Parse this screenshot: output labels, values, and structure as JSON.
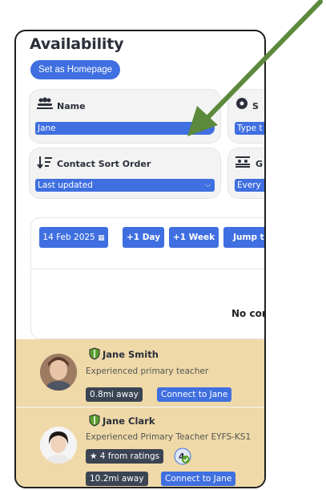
{
  "page": {
    "title": "Availability",
    "homepage_button": "Set as Homepage"
  },
  "filters": {
    "name": {
      "label": "Name",
      "value": "Jane"
    },
    "search_partial": {
      "label": "S",
      "placeholder": "Type t"
    },
    "sort": {
      "label": "Contact Sort Order",
      "value": "Last updated"
    },
    "group_partial": {
      "label": "G",
      "value": "Every"
    }
  },
  "date_toolbar": {
    "date": "14 Feb 2025",
    "plus_day": "+1 Day",
    "plus_week": "+1 Week",
    "jump": "Jump to"
  },
  "empty_state": "No conta",
  "contacts": [
    {
      "name": "Jane Smith",
      "description": "Experienced primary teacher",
      "distance": "0.8mi away",
      "connect": "Connect to Jane"
    },
    {
      "name": "Jane Clark",
      "description": "Experienced Primary Teacher EYFS-KS1",
      "rating": "4 from ratings",
      "distance": "10.2mi away",
      "connect": "Connect to Jane"
    }
  ],
  "colors": {
    "accent": "#3f6fe0",
    "contact_bg": "#efd9a8",
    "chip_dark": "#3a4453",
    "shield": "#5aa02c",
    "annotation_arrow": "#5c8a3c"
  }
}
